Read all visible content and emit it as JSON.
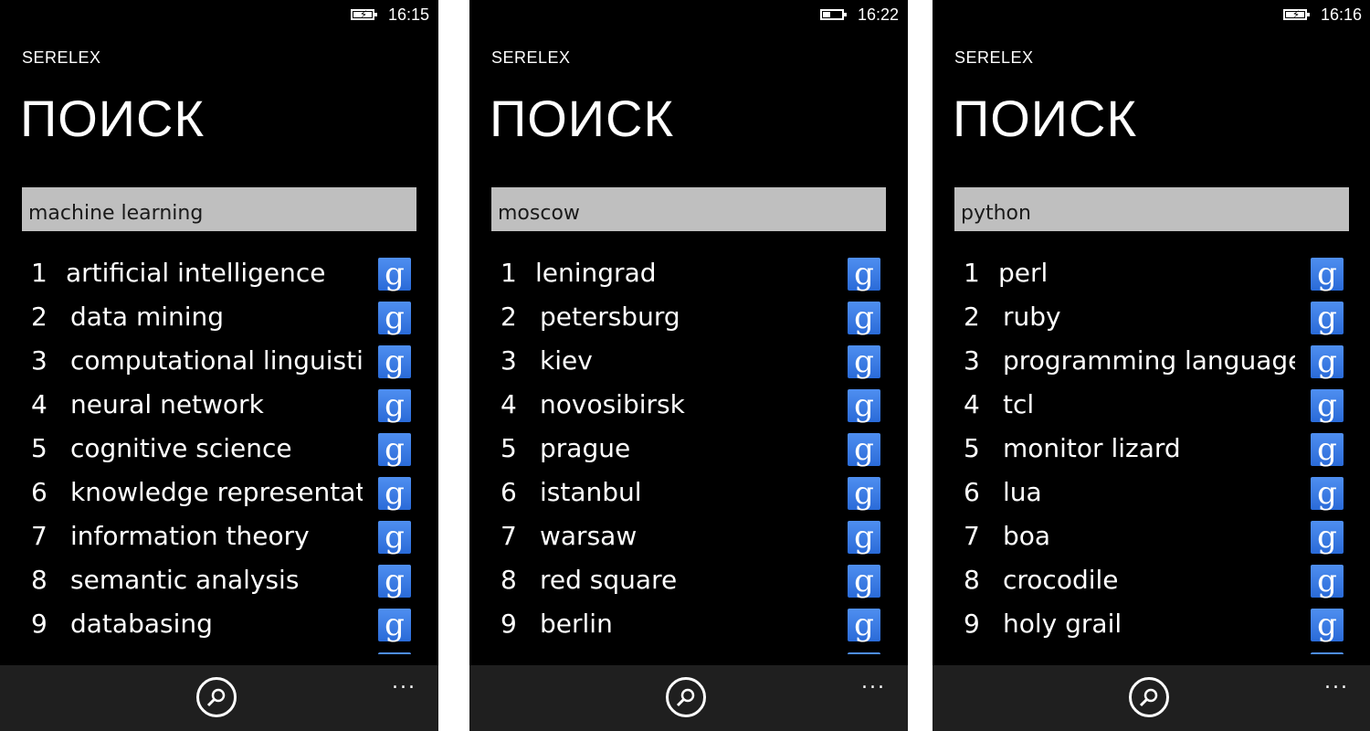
{
  "phones": [
    {
      "time": "16:15",
      "charging": true,
      "app_name": "SERELEX",
      "page_title": "ПОИСК",
      "query": "machine learning",
      "results": [
        {
          "num": "1",
          "label": "artificial intelligence"
        },
        {
          "num": "2",
          "label": "data mining"
        },
        {
          "num": "3",
          "label": "computational linguistic"
        },
        {
          "num": "4",
          "label": "neural network"
        },
        {
          "num": "5",
          "label": "cognitive science"
        },
        {
          "num": "6",
          "label": "knowledge representati"
        },
        {
          "num": "7",
          "label": "information theory"
        },
        {
          "num": "8",
          "label": "semantic analysis"
        },
        {
          "num": "9",
          "label": "databasing"
        }
      ]
    },
    {
      "time": "16:22",
      "charging": false,
      "app_name": "SERELEX",
      "page_title": "ПОИСК",
      "query": "moscow",
      "results": [
        {
          "num": "1",
          "label": "leningrad"
        },
        {
          "num": "2",
          "label": "petersburg"
        },
        {
          "num": "3",
          "label": "kiev"
        },
        {
          "num": "4",
          "label": "novosibirsk"
        },
        {
          "num": "5",
          "label": "prague"
        },
        {
          "num": "6",
          "label": "istanbul"
        },
        {
          "num": "7",
          "label": "warsaw"
        },
        {
          "num": "8",
          "label": "red square"
        },
        {
          "num": "9",
          "label": "berlin"
        }
      ]
    },
    {
      "time": "16:16",
      "charging": true,
      "app_name": "SERELEX",
      "page_title": "ПОИСК",
      "query": "python",
      "results": [
        {
          "num": "1",
          "label": "perl"
        },
        {
          "num": "2",
          "label": "ruby"
        },
        {
          "num": "3",
          "label": "programming language"
        },
        {
          "num": "4",
          "label": "tcl"
        },
        {
          "num": "5",
          "label": "monitor lizard"
        },
        {
          "num": "6",
          "label": "lua"
        },
        {
          "num": "7",
          "label": "boa"
        },
        {
          "num": "8",
          "label": "crocodile"
        },
        {
          "num": "9",
          "label": "holy grail"
        }
      ]
    }
  ],
  "google_icon_glyph": "g",
  "more_glyph": "...",
  "icons": {
    "result_action": "google-search-icon",
    "appbar_search": "search-icon",
    "battery": "battery-icon"
  },
  "colors": {
    "background": "#000000",
    "input": "#bfbfbf",
    "google": "#3a7be0",
    "appbar": "#1f1f1f"
  }
}
